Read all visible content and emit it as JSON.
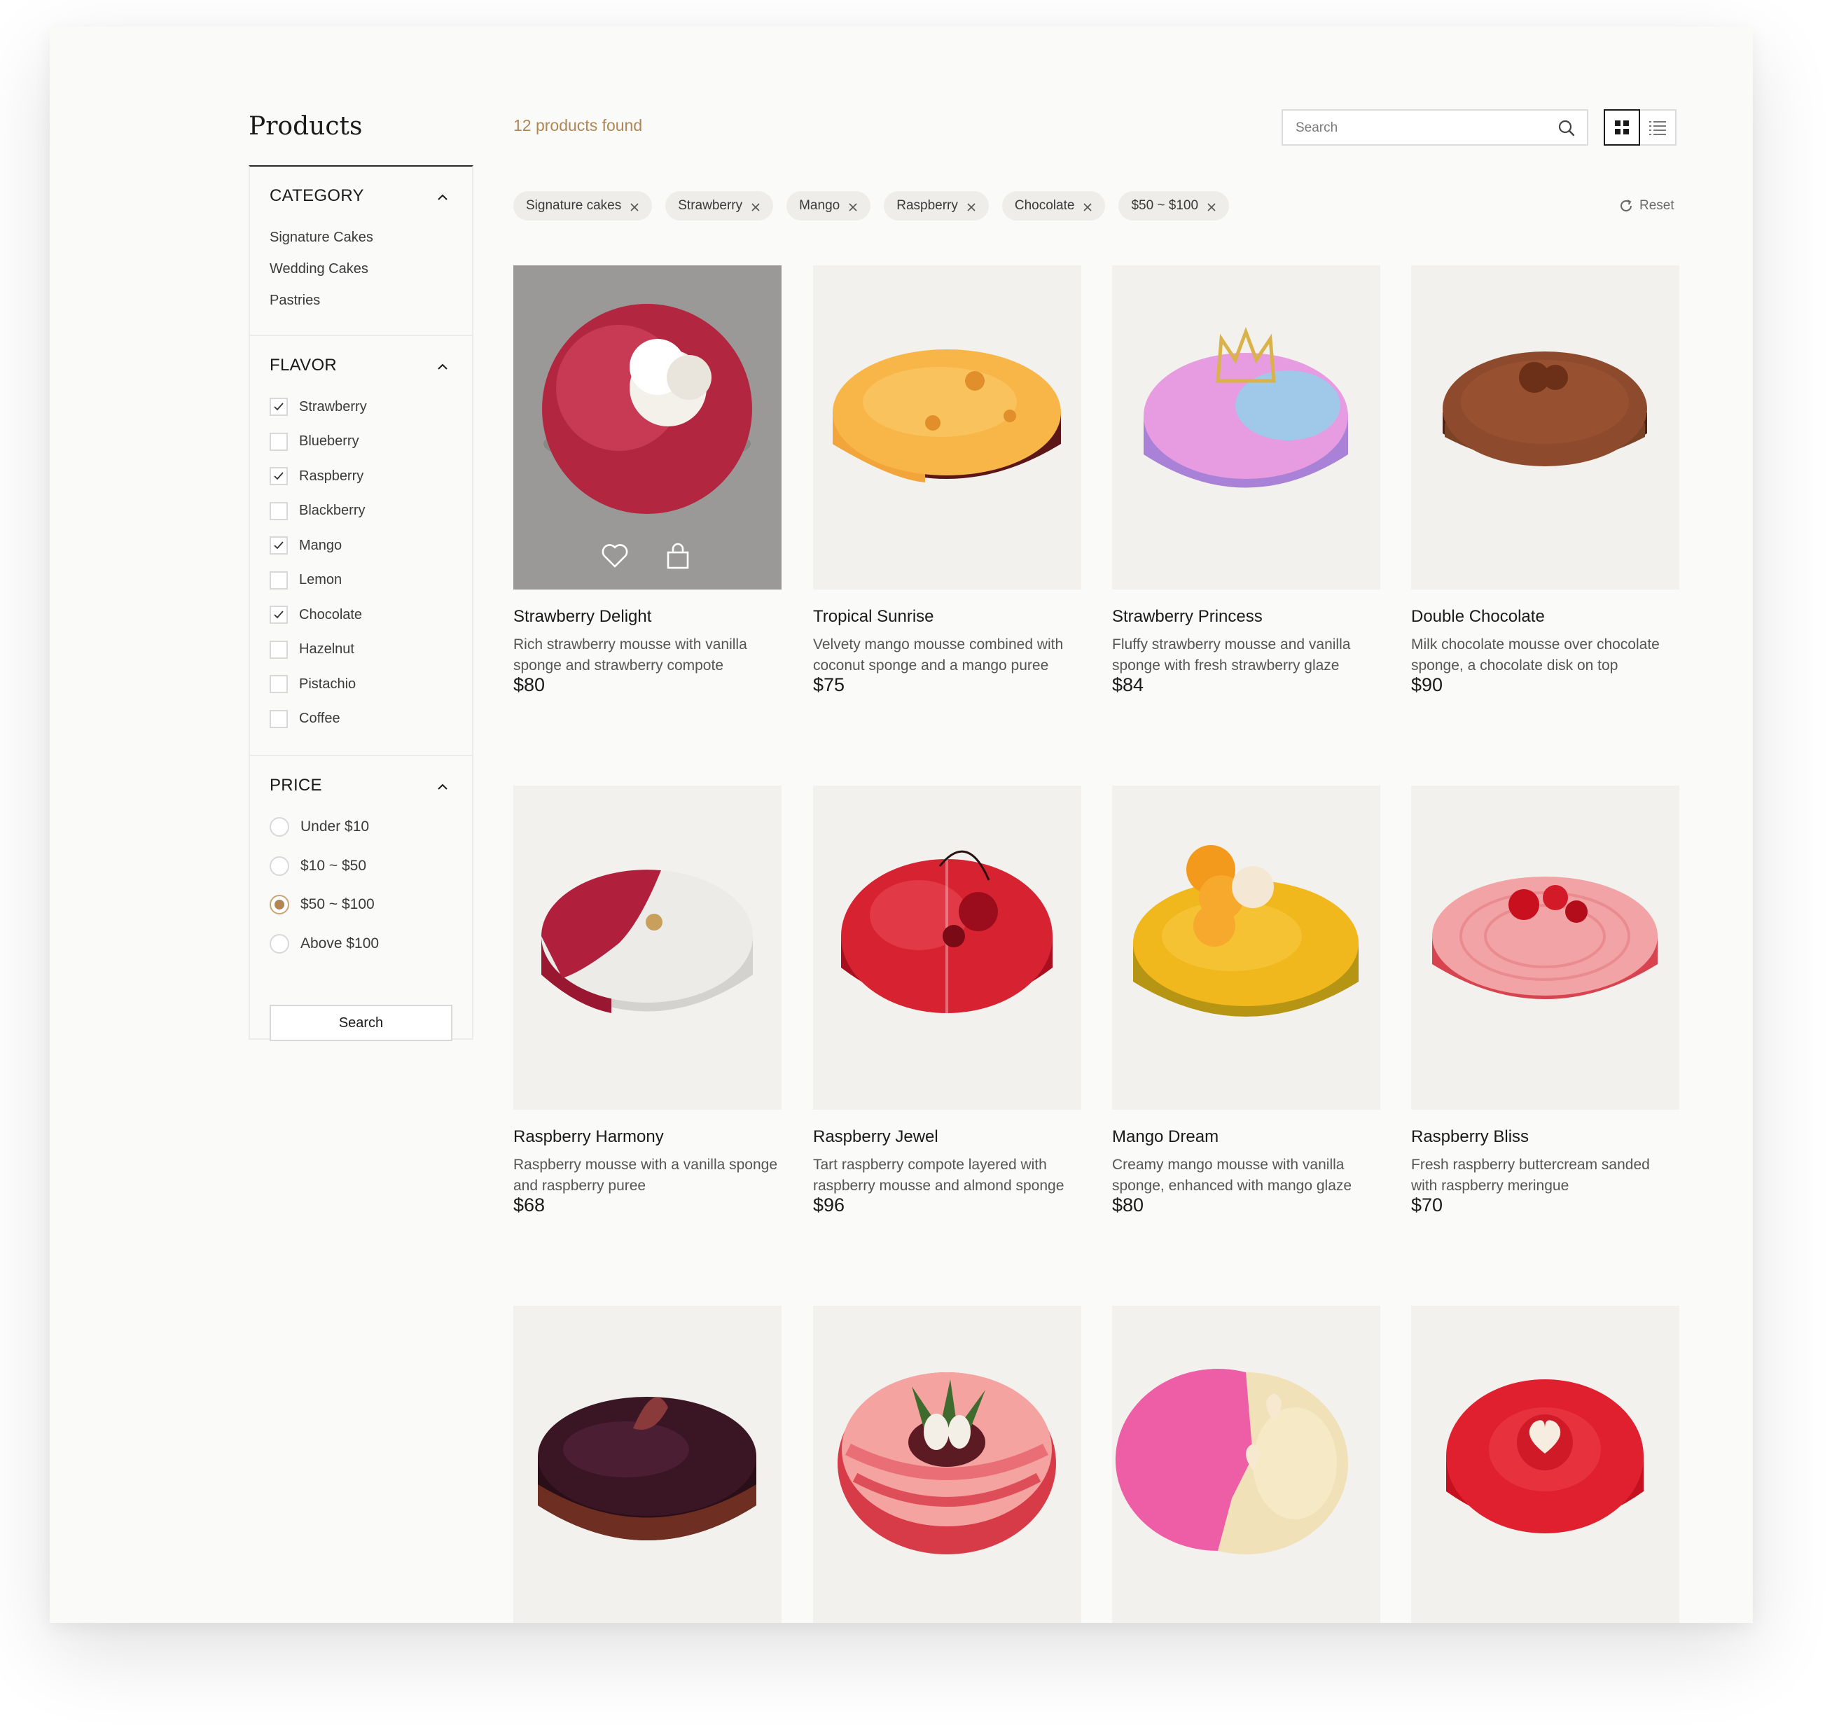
{
  "page": {
    "title": "Products"
  },
  "sidebar": {
    "category": {
      "heading": "CATEGORY",
      "items": [
        "Signature Cakes",
        "Wedding Cakes",
        "Pastries"
      ]
    },
    "flavor": {
      "heading": "FLAVOR",
      "items": [
        {
          "label": "Strawberry",
          "checked": true
        },
        {
          "label": "Blueberry",
          "checked": false
        },
        {
          "label": "Raspberry",
          "checked": true
        },
        {
          "label": "Blackberry",
          "checked": false
        },
        {
          "label": "Mango",
          "checked": true
        },
        {
          "label": "Lemon",
          "checked": false
        },
        {
          "label": "Chocolate",
          "checked": true
        },
        {
          "label": "Hazelnut",
          "checked": false
        },
        {
          "label": "Pistachio",
          "checked": false
        },
        {
          "label": "Coffee",
          "checked": false
        }
      ]
    },
    "price": {
      "heading": "PRICE",
      "options": [
        {
          "label": "Under $10",
          "selected": false
        },
        {
          "label": "$10 ~ $50",
          "selected": false
        },
        {
          "label": "$50 ~ $100",
          "selected": true
        },
        {
          "label": "Above $100",
          "selected": false
        }
      ]
    },
    "search_label": "Search"
  },
  "topbar": {
    "results": "12 products found",
    "search_placeholder": "Search",
    "active_view": "grid"
  },
  "filters": {
    "chips": [
      "Signature cakes",
      "Strawberry",
      "Mango",
      "Raspberry",
      "Chocolate",
      "$50 ~ $100"
    ],
    "reset_label": "Reset"
  },
  "colors": {
    "accent": "#b08654",
    "image_bg": "#f3f1ed",
    "page_bg": "#fafaf9"
  },
  "products": [
    {
      "name": "Strawberry Delight",
      "desc": "Rich strawberry mousse with vanilla sponge and strawberry compote",
      "price": "$80",
      "hovered": true
    },
    {
      "name": "Tropical Sunrise",
      "desc": "Velvety mango mousse combined with coconut sponge and a mango puree",
      "price": "$75"
    },
    {
      "name": "Strawberry Princess",
      "desc": "Fluffy strawberry mousse and vanilla sponge with fresh strawberry glaze",
      "price": "$84"
    },
    {
      "name": "Double Chocolate",
      "desc": "Milk chocolate mousse over chocolate sponge, a chocolate disk on top",
      "price": "$90"
    },
    {
      "name": "Raspberry Harmony",
      "desc": "Raspberry mousse with a vanilla sponge and raspberry puree",
      "price": "$68"
    },
    {
      "name": "Raspberry Jewel",
      "desc": "Tart raspberry compote layered with raspberry mousse and almond sponge",
      "price": "$96"
    },
    {
      "name": "Mango Dream",
      "desc": "Creamy mango mousse with vanilla sponge, enhanced with mango glaze",
      "price": "$80"
    },
    {
      "name": "Raspberry Bliss",
      "desc": "Fresh raspberry buttercream sanded with raspberry meringue",
      "price": "$70"
    },
    {
      "name": "",
      "desc": "",
      "price": ""
    },
    {
      "name": "",
      "desc": "",
      "price": ""
    },
    {
      "name": "",
      "desc": "",
      "price": ""
    },
    {
      "name": "",
      "desc": "",
      "price": ""
    }
  ]
}
